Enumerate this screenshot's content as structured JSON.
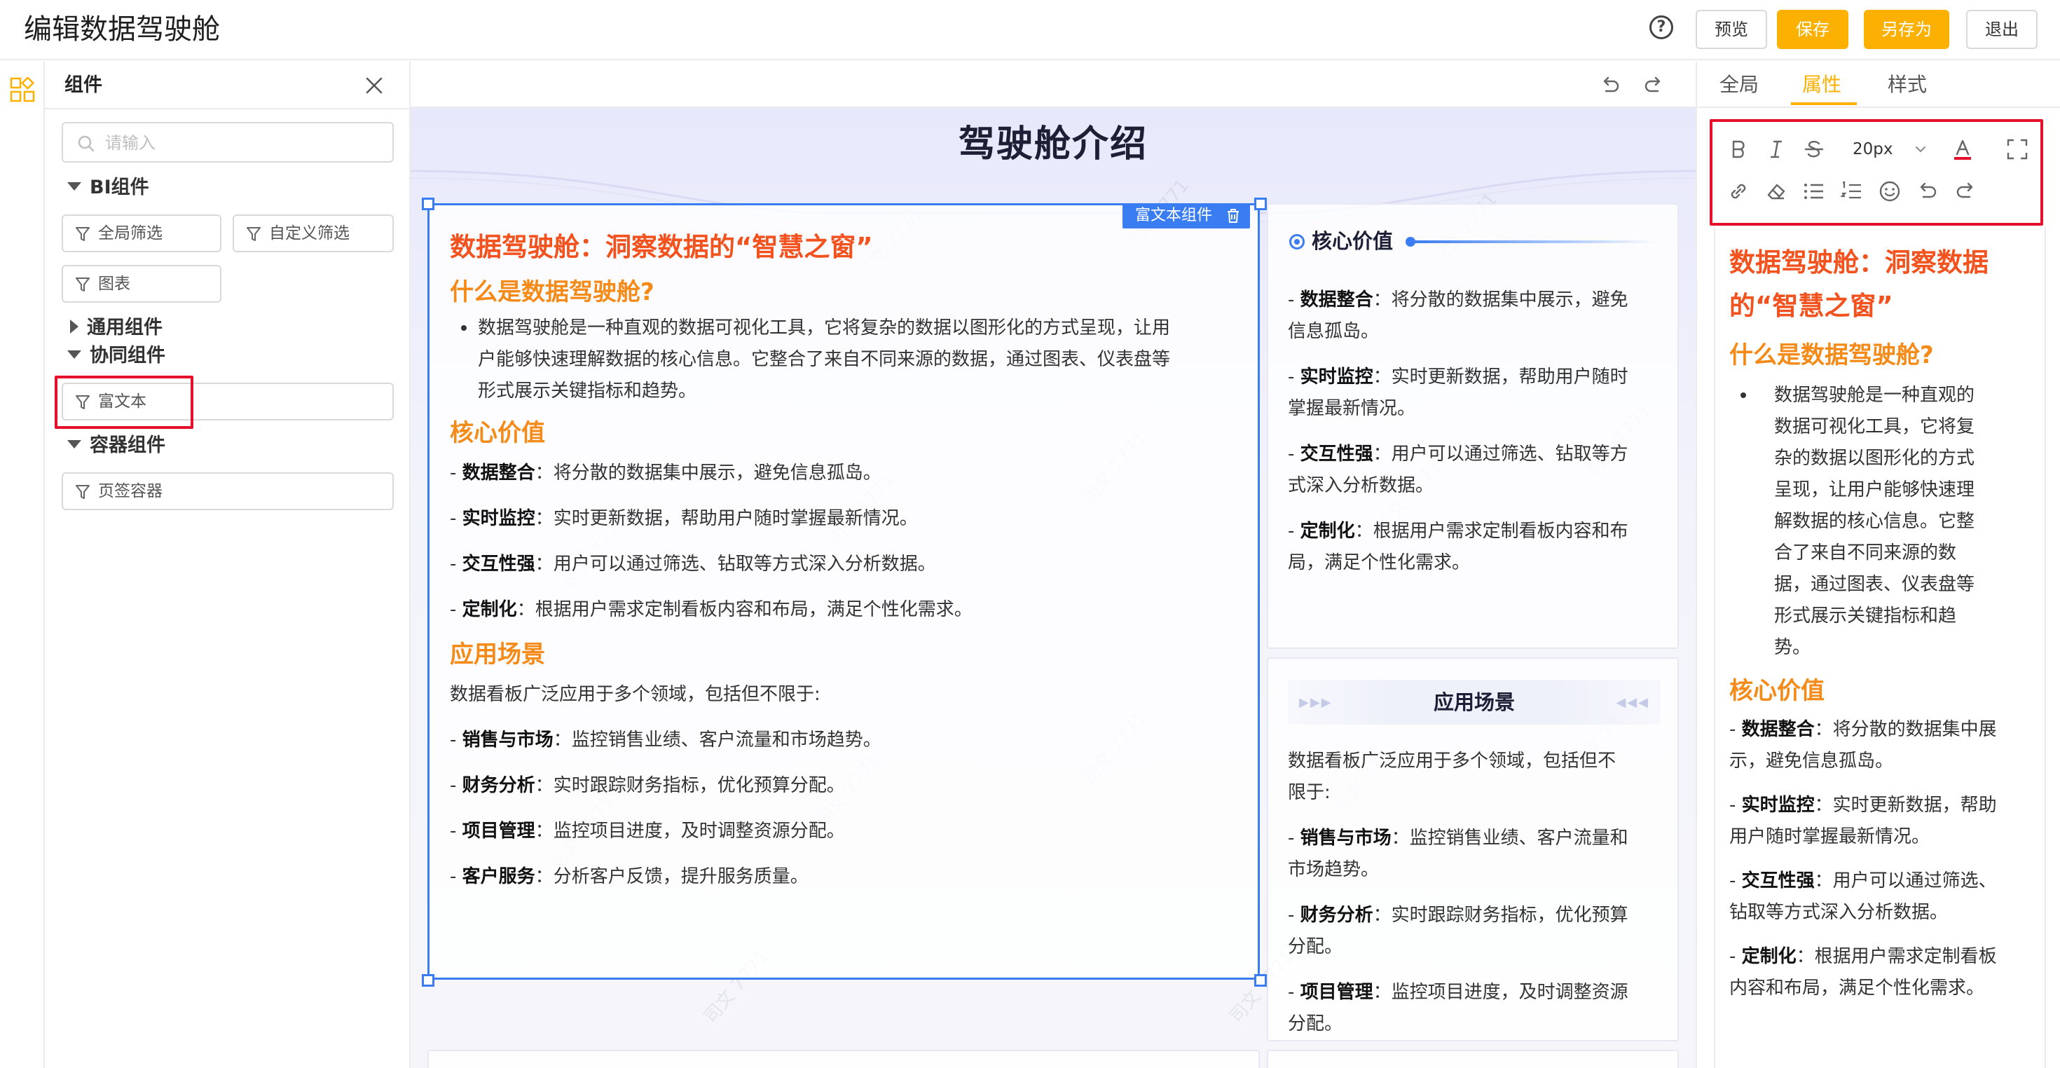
{
  "header": {
    "title": "编辑数据驾驶舱",
    "help_icon_glyph": "?",
    "preview_label": "预览",
    "save_label": "保存",
    "save_as_label": "另存为",
    "exit_label": "退出"
  },
  "left_rail": {
    "icon": "components-icon"
  },
  "components_panel": {
    "title": "组件",
    "search_placeholder": "请输入",
    "groups": [
      {
        "label": "BI组件",
        "expanded": true,
        "items": [
          "全局筛选",
          "自定义筛选",
          "图表"
        ]
      },
      {
        "label": "通用组件",
        "expanded": false,
        "items": []
      },
      {
        "label": "协同组件",
        "expanded": true,
        "items": [
          "富文本"
        ]
      },
      {
        "label": "容器组件",
        "expanded": true,
        "items": [
          "页签容器"
        ]
      }
    ]
  },
  "canvas": {
    "dashboard_title": "驾驶舱介绍",
    "watermark_text": "司文 7771",
    "selected_label": "富文本组件",
    "richtext": {
      "h1": "数据驾驶舱：洞察数据的“智慧之窗”",
      "h2_what": "什么是数据驾驶舱?",
      "what_bullet": "数据驾驶舱是一种直观的数据可视化工具，它将复杂的数据以图形化的方式呈现，让用户能够快速理解数据的核心信息。它整合了来自不同来源的数据，通过图表、仪表盘等形式展示关键指标和趋势。",
      "h2_core": "核心价值",
      "core_items": [
        {
          "term": "数据整合",
          "desc": "将分散的数据集中展示，避免信息孤岛。"
        },
        {
          "term": "实时监控",
          "desc": "实时更新数据，帮助用户随时掌握最新情况。"
        },
        {
          "term": "交互性强",
          "desc": "用户可以通过筛选、钻取等方式深入分析数据。"
        },
        {
          "term": "定制化",
          "desc": "根据用户需求定制看板内容和布局，满足个性化需求。"
        }
      ],
      "h2_app": "应用场景",
      "app_intro": "数据看板广泛应用于多个领域，包括但不限于:",
      "app_items": [
        {
          "term": "销售与市场",
          "desc": "监控销售业绩、客户流量和市场趋势。"
        },
        {
          "term": "财务分析",
          "desc": "实时跟踪财务指标，优化预算分配。"
        },
        {
          "term": "项目管理",
          "desc": "监控项目进度，及时调整资源分配。"
        },
        {
          "term": "客户服务",
          "desc": "分析客户反馈，提升服务质量。"
        }
      ]
    },
    "core_card": {
      "title": "核心价值",
      "lines": [
        {
          "term": "数据整合",
          "desc1": "：将分散的数据集中展示，避免",
          "desc2": "信息孤岛。"
        },
        {
          "term": "实时监控",
          "desc1": "：实时更新数据，帮助用户随时",
          "desc2": "掌握最新情况。"
        },
        {
          "term": "交互性强",
          "desc1": "：用户可以通过筛选、钻取等方",
          "desc2": "式深入分析数据。"
        },
        {
          "term": "定制化",
          "desc1": "：根据用户需求定制看板内容和布",
          "desc2": "局，满足个性化需求。"
        }
      ]
    },
    "app_card": {
      "title": "应用场景",
      "intro1": "数据看板广泛应用于多个领域，包括但不",
      "intro2": "限于:",
      "lines": [
        {
          "term": "销售与市场",
          "desc1": "：监控销售业绩、客户流量和",
          "desc2": "市场趋势。"
        },
        {
          "term": "财务分析",
          "desc1": "：实时跟踪财务指标，优化预算",
          "desc2": "分配。"
        },
        {
          "term": "项目管理",
          "desc1": "：监控项目进度，及时调整资源",
          "desc2": "分配。"
        }
      ]
    }
  },
  "properties_panel": {
    "tabs": [
      {
        "label": "全局",
        "active": false
      },
      {
        "label": "属性",
        "active": true
      },
      {
        "label": "样式",
        "active": false
      }
    ],
    "font_size": "20px",
    "toolbar_icons": [
      "bold-icon",
      "italic-icon",
      "strikethrough-icon",
      "font-color-icon",
      "fullscreen-icon",
      "link-icon",
      "eraser-icon",
      "bullet-list-icon",
      "ordered-list-icon",
      "emoji-icon",
      "undo-icon",
      "redo-icon"
    ],
    "preview": {
      "h1_line1": "数据驾驶舱：洞察数据",
      "h1_line2": "的“智慧之窗”",
      "h2_what": "什么是数据驾驶舱?",
      "what_lines": [
        "数据驾驶舱是一种直观的",
        "数据可视化工具，它将复",
        "杂的数据以图形化的方式",
        "呈现，让用户能够快速理",
        "解数据的核心信息。它整",
        "合了来自不同来源的数",
        "据，通过图表、仪表盘等",
        "形式展示关键指标和趋",
        "势。"
      ],
      "h2_core": "核心价值",
      "core_lines": [
        {
          "term": "数据整合",
          "desc1": "：将分散的数据集中展",
          "desc2": "示，避免信息孤岛。"
        },
        {
          "term": "实时监控",
          "desc1": "：实时更新数据，帮助",
          "desc2": "用户随时掌握最新情况。"
        },
        {
          "term": "交互性强",
          "desc1": "：用户可以通过筛选、",
          "desc2": "钻取等方式深入分析数据。"
        },
        {
          "term": "定制化",
          "desc1": "：根据用户需求定制看板",
          "desc2": "内容和布局，满足个性化需求。"
        }
      ]
    }
  },
  "colors": {
    "accent": "#fbb002",
    "selection": "#3a7cf2",
    "heading_red": "#f2521e",
    "heading_orange": "#f48a18",
    "highlight_box": "#e5102c"
  }
}
